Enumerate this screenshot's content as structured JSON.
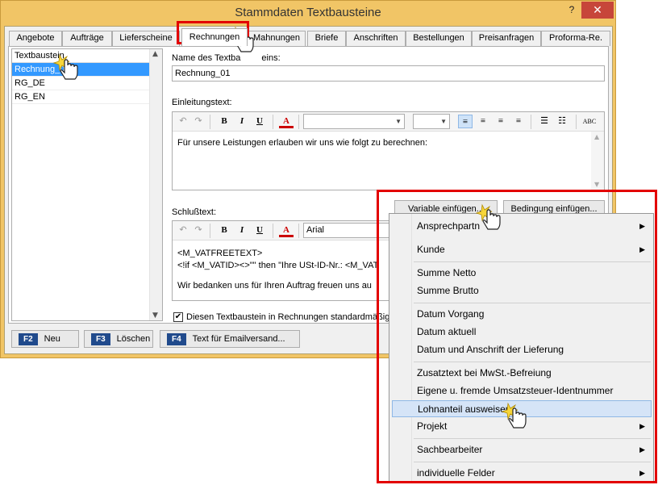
{
  "window": {
    "title": "Stammdaten Textbausteine",
    "help_glyph": "?",
    "close_glyph": "✕"
  },
  "tabs": [
    {
      "label": "Angebote"
    },
    {
      "label": "Aufträge"
    },
    {
      "label": "Lieferscheine"
    },
    {
      "label": "Rechnungen"
    },
    {
      "label": "Mahnungen"
    },
    {
      "label": "Briefe"
    },
    {
      "label": "Anschriften"
    },
    {
      "label": "Bestellungen"
    },
    {
      "label": "Preisanfragen"
    },
    {
      "label": "Proforma-Re."
    }
  ],
  "active_tab": "Rechnungen",
  "list": {
    "header": "Textbaustein",
    "items": [
      {
        "label": "Rechnung_01",
        "display": "Rechnung_0"
      },
      {
        "label": "RG_DE",
        "display": "RG_DE"
      },
      {
        "label": "RG_EN",
        "display": "RG_EN"
      }
    ],
    "selected": "Rechnung_01"
  },
  "form": {
    "name_label": "Name des Textbausteins:",
    "name_label_visible": "Name des Textba",
    "name_label_tail": "eins:",
    "name_value": "Rechnung_01",
    "intro_label": "Einleitungstext:",
    "intro_text": "Für unsere Leistungen erlauben wir uns wie folgt zu berechnen:",
    "closing_label": "Schlußtext:",
    "closing_font": "Arial",
    "closing_lines": [
      "<M_VATFREETEXT>",
      "<!if <M_VATID><>\"\" then \"Ihre USt-ID-Nr.: <M_VAT",
      "",
      "Wir bedanken uns für Ihren Auftrag freuen uns au"
    ],
    "default_checkbox_label": "Diesen Textbaustein in Rechnungen standardmäßig ve",
    "default_checkbox_checked": "✔"
  },
  "toolbar": {
    "undo": "↶",
    "redo": "↷",
    "bold": "B",
    "italic": "I",
    "underline": "U",
    "font_color": "A",
    "align_icons": [
      "≡",
      "≡",
      "≡",
      "≡"
    ],
    "bullets": "☰",
    "numbering": "☷",
    "spell": "ABC"
  },
  "buttons": {
    "variable_insert": "Variable einfügen...",
    "condition_insert": "Bedingung einfügen...",
    "f2_key": "F2",
    "f2_label": "Neu",
    "f3_key": "F3",
    "f3_label": "Löschen",
    "f4_key": "F4",
    "f4_label": "Text für Emailversand..."
  },
  "menu": {
    "items": [
      {
        "label": "Ansprechpartner",
        "display": "Ansprechpartn",
        "submenu": "▶"
      },
      {
        "label": "Kunde",
        "submenu": "▶"
      },
      {
        "label": "Summe Netto"
      },
      {
        "label": "Summe Brutto"
      },
      {
        "label": "Datum Vorgang"
      },
      {
        "label": "Datum aktuell"
      },
      {
        "label": "Datum und Anschrift der Lieferung"
      },
      {
        "label": "Zusatztext bei MwSt.-Befreiung"
      },
      {
        "label": "Eigene u. fremde Umsatzsteuer-Identnummer"
      },
      {
        "label": "Lohnanteil ausweisen"
      },
      {
        "label": "Projekt",
        "submenu": "▶"
      },
      {
        "label": "Sachbearbeiter",
        "submenu": "▶"
      },
      {
        "label": "individuelle Felder",
        "submenu": "▶"
      }
    ],
    "highlighted": "Lohnanteil ausweisen"
  },
  "colors": {
    "window_frame": "#f1c566",
    "close_button": "#c7463a",
    "selection": "#3399ff",
    "fkey_badge": "#204a8c",
    "annotation_red": "#e30000",
    "menu_highlight": "#d5e4f7"
  }
}
